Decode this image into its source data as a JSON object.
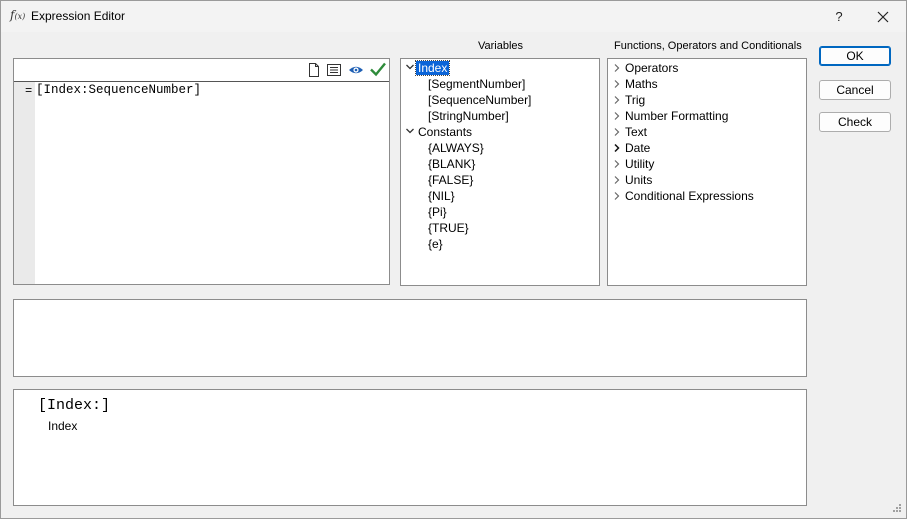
{
  "window": {
    "title": "Expression Editor",
    "icon": "f(x)",
    "help_glyph": "?",
    "close_glyph": "✕"
  },
  "editor": {
    "prefix": "=",
    "expression": "[Index:SequenceNumber]",
    "toolbar": [
      "new-document-icon",
      "list-view-icon",
      "preview-eye-icon",
      "check-icon"
    ],
    "check_color": "#2e8b3a",
    "eye_color": "#1e5fb4"
  },
  "variables": {
    "header": "Variables",
    "groups": [
      {
        "label": "Index",
        "expanded": true,
        "selected": true,
        "children": [
          "[SegmentNumber]",
          "[SequenceNumber]",
          "[StringNumber]"
        ]
      },
      {
        "label": "Constants",
        "expanded": true,
        "children": [
          "{ALWAYS}",
          "{BLANK}",
          "{FALSE}",
          "{NIL}",
          "{Pi}",
          "{TRUE}",
          "{e}"
        ]
      }
    ]
  },
  "functions": {
    "header": "Functions, Operators and Conditionals",
    "items": [
      "Operators",
      "Maths",
      "Trig",
      "Number Formatting",
      "Text",
      "Date",
      "Utility",
      "Units",
      "Conditional Expressions"
    ]
  },
  "buttons": {
    "ok": "OK",
    "cancel": "Cancel",
    "check": "Check"
  },
  "result": "",
  "help": {
    "signature": "[Index:]",
    "description": "Index"
  },
  "colors": {
    "selection": "#0a64d8",
    "default_button_border": "#0067c0"
  }
}
